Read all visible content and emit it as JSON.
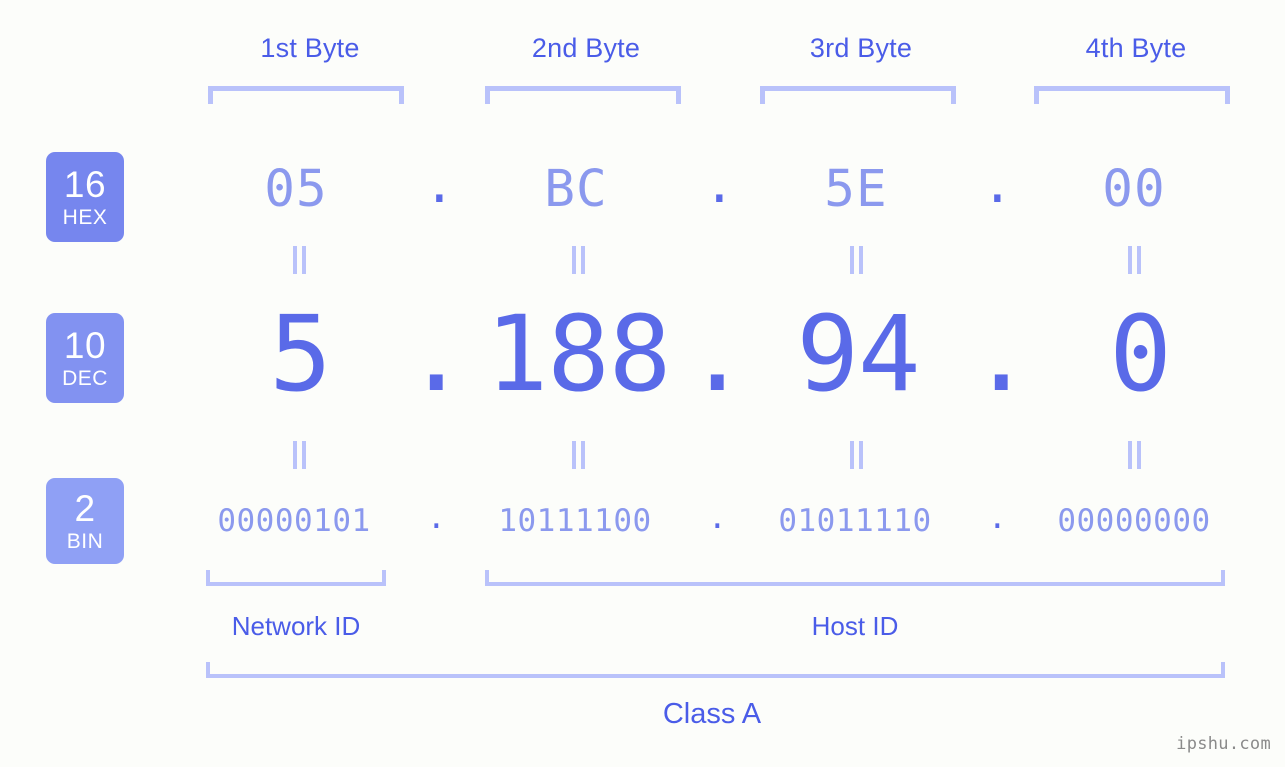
{
  "page": {
    "background_color": "#fcfdfa",
    "accent_color": "#5a6ae8",
    "muted_accent_color": "#8b99ee",
    "bracket_color": "#b9c2fa",
    "watermark": "ipshu.com"
  },
  "byte_headers": [
    {
      "label": "1st Byte"
    },
    {
      "label": "2nd Byte"
    },
    {
      "label": "3rd Byte"
    },
    {
      "label": "4th Byte"
    }
  ],
  "rows": [
    {
      "id": "hex",
      "badge_number": "16",
      "badge_name": "HEX",
      "badge_color": "#7686ee",
      "values": [
        "05",
        "BC",
        "5E",
        "00"
      ],
      "separator": "."
    },
    {
      "id": "dec",
      "badge_number": "10",
      "badge_name": "DEC",
      "badge_color": "#8292f1",
      "values": [
        "5",
        "188",
        "94",
        "0"
      ],
      "separator": "."
    },
    {
      "id": "bin",
      "badge_number": "2",
      "badge_name": "BIN",
      "badge_color": "#8fa0f5",
      "values": [
        "00000101",
        "10111100",
        "01011110",
        "00000000"
      ],
      "separator": "."
    }
  ],
  "equals_marks": {
    "symbol": "=",
    "count_per_row": 4,
    "rows": 2
  },
  "sections": [
    {
      "id": "network-id",
      "label": "Network ID",
      "spans_bytes": "1"
    },
    {
      "id": "host-id",
      "label": "Host ID",
      "spans_bytes": "2-4"
    }
  ],
  "class": {
    "label": "Class A",
    "spans_bytes": "1-4"
  }
}
